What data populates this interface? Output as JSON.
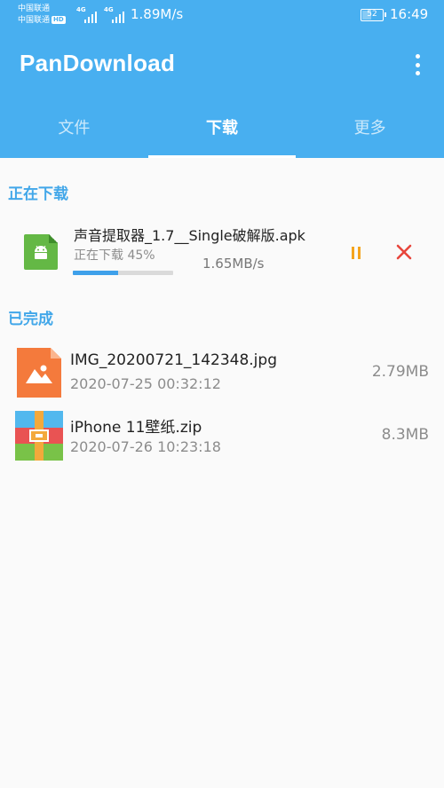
{
  "status_bar": {
    "carrier_1": "中国联通",
    "carrier_2": "中国联通",
    "hd_badge": "HD",
    "network_1": "4G",
    "network_2": "4G",
    "net_speed": "1.89M/s",
    "battery": "52",
    "battery_level_percent": 52,
    "time": "16:49"
  },
  "app": {
    "title": "PanDownload",
    "accent_color": "#48aff0",
    "icons": {
      "menu": "more-vertical-icon",
      "apk": "android-file-icon",
      "image": "image-file-icon",
      "archive": "zip-archive-icon",
      "pause": "pause-icon",
      "cancel": "close-icon"
    }
  },
  "tabs": [
    {
      "label": "文件",
      "active": false
    },
    {
      "label": "下载",
      "active": true
    },
    {
      "label": "更多",
      "active": false
    }
  ],
  "downloading": {
    "section_title": "正在下载",
    "items": [
      {
        "name": "声音提取器_1.7__Single破解版.apk",
        "status": "正在下载 45%",
        "progress_percent": 45,
        "speed": "1.65MB/s"
      }
    ]
  },
  "completed": {
    "section_title": "已完成",
    "items": [
      {
        "name": "IMG_20200721_142348.jpg",
        "date": "2020-07-25 00:32:12",
        "size": "2.79MB",
        "type": "image"
      },
      {
        "name": "iPhone 11壁纸.zip",
        "date": "2020-07-26 10:23:18",
        "size": "8.3MB",
        "type": "archive"
      }
    ]
  }
}
